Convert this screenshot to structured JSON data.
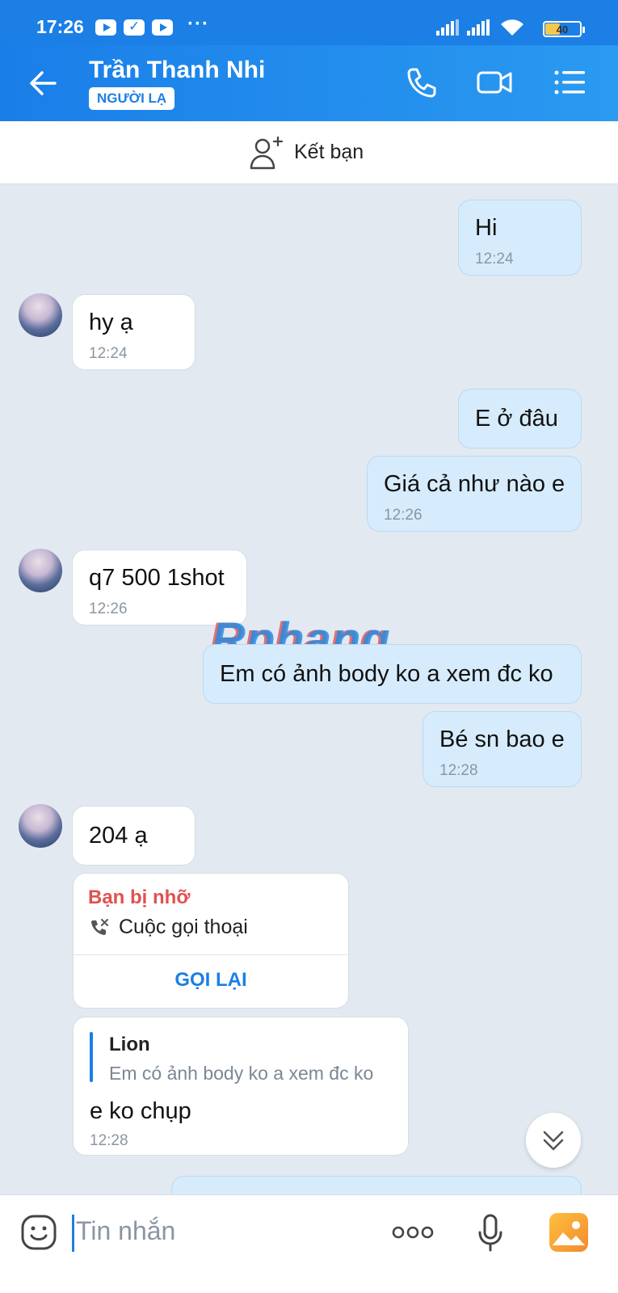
{
  "status_bar": {
    "time": "17:26",
    "battery": "40",
    "battery_level": 0.4,
    "icons": [
      "youtube-icon",
      "app-check-icon",
      "youtube-icon",
      "more-dots-icon",
      "signal-icon",
      "signal-icon",
      "wifi-icon",
      "battery-icon"
    ]
  },
  "header": {
    "name": "Trần Thanh Nhi",
    "tag": "NGƯỜI LẠ",
    "icons": [
      "back-arrow-icon",
      "phone-icon",
      "video-call-icon",
      "menu-icon"
    ]
  },
  "friend_bar": {
    "label": "Kết bạn",
    "icon": "add-friend-icon"
  },
  "messages": [
    {
      "side": "out",
      "text": "Hi",
      "time": "12:24"
    },
    {
      "side": "in",
      "text": "hy ạ",
      "time": "12:24"
    },
    {
      "side": "out",
      "text": "E ở đâu",
      "time": ""
    },
    {
      "side": "out",
      "text": "Giá cả như nào e",
      "time": "12:26"
    },
    {
      "side": "in",
      "text": "q7 500 1shot",
      "time": "12:26"
    },
    {
      "side": "out",
      "text": "Em có ảnh body ko a xem đc ko",
      "time": ""
    },
    {
      "side": "out",
      "text": "Bé sn bao e",
      "time": "12:28"
    },
    {
      "side": "in",
      "text": "204 ạ",
      "time": ""
    }
  ],
  "missed_call": {
    "title": "Bạn bị nhỡ",
    "desc": "Cuộc gọi thoại",
    "action": "GỌI LẠI"
  },
  "quoted_reply": {
    "quote_name": "Lion",
    "quote_text": "Em có ảnh body ko a xem đc ko",
    "text": "e ko chụp",
    "time": "12:28"
  },
  "watermark": "Rphang",
  "input_bar": {
    "placeholder": "Tin nhắn",
    "icons": [
      "emoji-icon",
      "more-options-icon",
      "microphone-icon",
      "gallery-icon"
    ]
  },
  "colors": {
    "brand": "#1b7fe6",
    "outgoing_bubble": "#d6ecfd",
    "chat_background": "#e2e9f1",
    "missed_call_red": "#e0524e"
  }
}
